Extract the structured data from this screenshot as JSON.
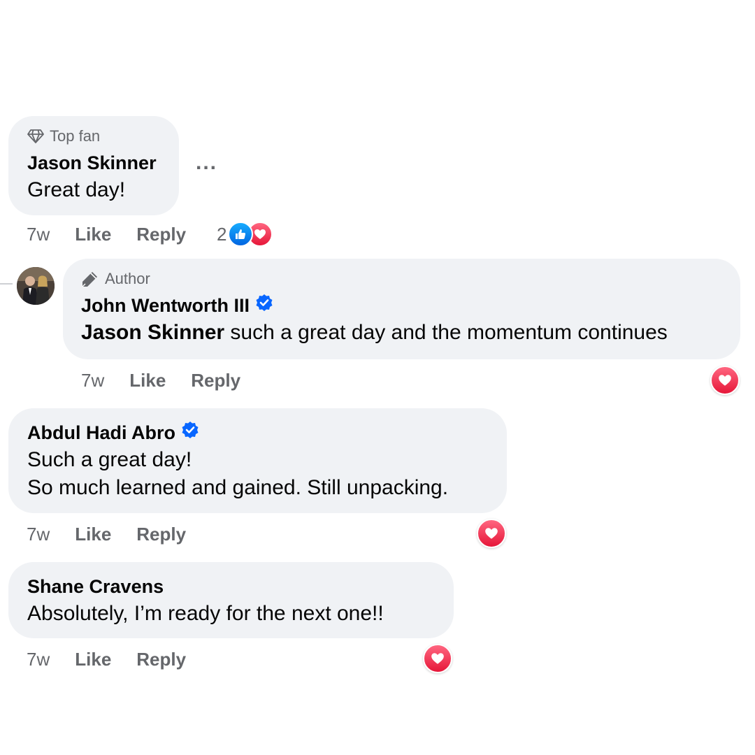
{
  "comments": [
    {
      "badge": "Top fan",
      "badge_icon": "diamond-icon",
      "author": "Jason Skinner",
      "text": "Great day!",
      "time": "7w",
      "like_label": "Like",
      "reply_label": "Reply",
      "reaction_count": "2",
      "reactions": [
        "like",
        "love"
      ]
    },
    {
      "badge": "Author",
      "badge_icon": "pen-icon",
      "author": "John Wentworth III",
      "verified": true,
      "mention": "Jason Skinner",
      "text": " such a great day and the momentum continues",
      "time": "7w",
      "like_label": "Like",
      "reply_label": "Reply",
      "reactions": [
        "love"
      ]
    },
    {
      "author": "Abdul Hadi Abro",
      "verified": true,
      "text_line1": "Such a great day!",
      "text_line2": "So much learned and gained. Still unpacking.",
      "time": "7w",
      "like_label": "Like",
      "reply_label": "Reply",
      "reactions": [
        "love"
      ]
    },
    {
      "author": "Shane Cravens",
      "text": "Absolutely, I’m ready for the next one!!",
      "time": "7w",
      "like_label": "Like",
      "reply_label": "Reply",
      "reactions": [
        "love"
      ]
    }
  ],
  "more_options_label": "...",
  "colors": {
    "bubble_bg": "#f0f2f5",
    "secondary_text": "#65676b",
    "verified_blue": "#0866ff",
    "like_blue": "#0165e1",
    "love_red": "#f33e58"
  }
}
